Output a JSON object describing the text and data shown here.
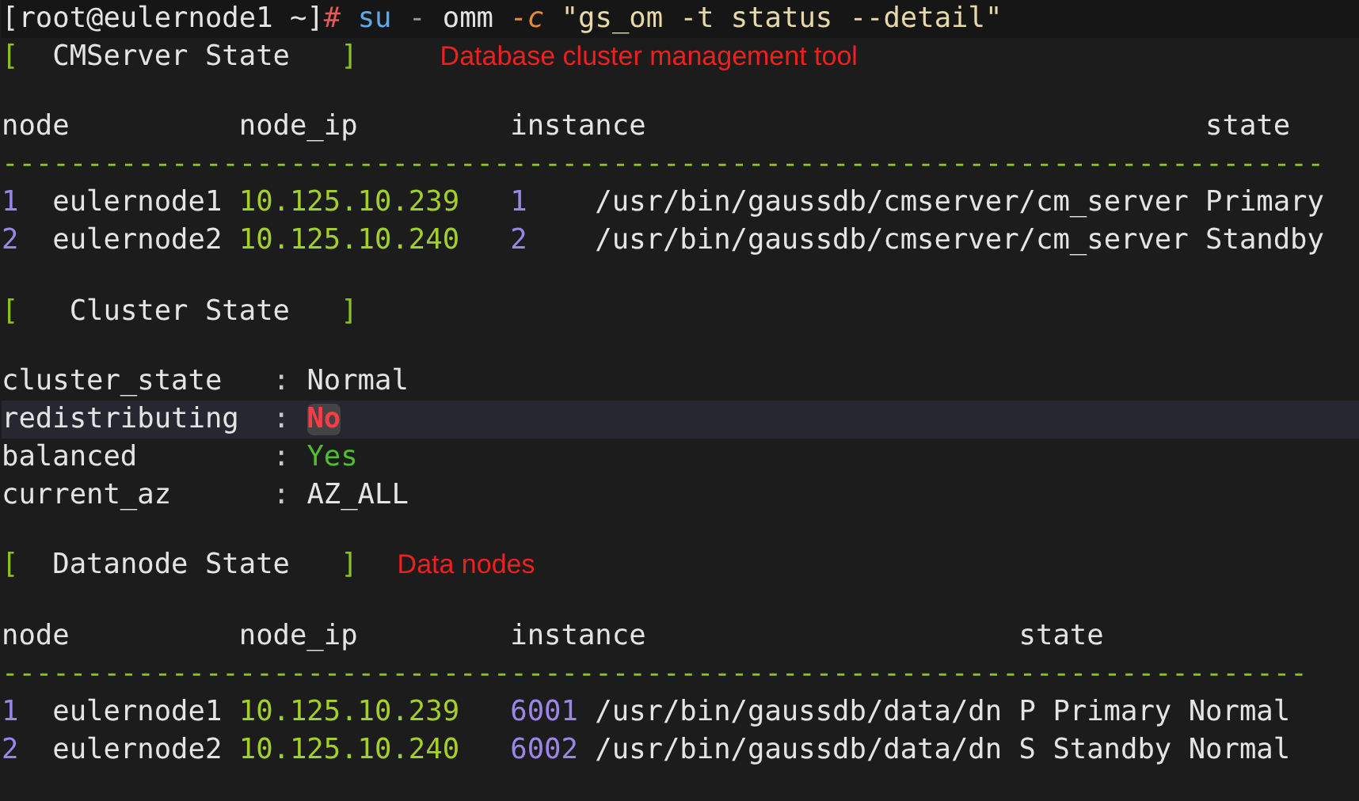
{
  "command": [
    {
      "kind": "prompt",
      "text": "[root@eulernode1 ~]"
    },
    {
      "kind": "symbol",
      "text": "#"
    },
    {
      "kind": "program",
      "text": "su"
    },
    {
      "kind": "dim",
      "text": "-"
    },
    {
      "kind": "plain",
      "text": "omm"
    },
    {
      "kind": "flag",
      "text": "-c"
    },
    {
      "kind": "string",
      "text": "\"gs_om -t status --detail\""
    }
  ],
  "sections": [
    {
      "kind": "table",
      "open": "[",
      "close": "]",
      "title": "CMServer State",
      "annotation": "Database cluster management tool",
      "columns": [
        "node",
        "node_ip",
        "instance",
        "state"
      ],
      "divider": "------------------------------------------------------------------------------",
      "rows": [
        {
          "index": "1",
          "node": "eulernode1",
          "node_ip": "10.125.10.239",
          "instance_id": "1",
          "path": "/usr/bin/gaussdb/cmserver/cm_server",
          "state": "Primary"
        },
        {
          "index": "2",
          "node": "eulernode2",
          "node_ip": "10.125.10.240",
          "instance_id": "2",
          "path": "/usr/bin/gaussdb/cmserver/cm_server",
          "state": "Standby"
        }
      ]
    },
    {
      "kind": "fields",
      "open": "[",
      "close": "]",
      "title": "Cluster State",
      "fields": [
        {
          "key": "cluster_state",
          "separator": ":",
          "value": "Normal",
          "color": "#e4e4e4",
          "selected": false
        },
        {
          "key": "redistributing",
          "separator": ":",
          "value": "No",
          "color": "#ff3b4a",
          "selected": true
        },
        {
          "key": "balanced",
          "separator": ":",
          "value": "Yes",
          "color": "#4fbf2f",
          "selected": false
        },
        {
          "key": "current_az",
          "separator": ":",
          "value": "AZ_ALL",
          "color": "#e4e4e4",
          "selected": false
        }
      ]
    },
    {
      "kind": "table",
      "open": "[",
      "close": "]",
      "title": "Datanode State",
      "annotation": "Data nodes",
      "columns": [
        "node",
        "node_ip",
        "instance",
        "state"
      ],
      "divider": "-----------------------------------------------------------------------------",
      "rows": [
        {
          "index": "1",
          "node": "eulernode1",
          "node_ip": "10.125.10.239",
          "instance_id": "6001",
          "path": "/usr/bin/gaussdb/data/dn",
          "state": "P Primary Normal"
        },
        {
          "index": "2",
          "node": "eulernode2",
          "node_ip": "10.125.10.240",
          "instance_id": "6002",
          "path": "/usr/bin/gaussdb/data/dn",
          "state": "S Standby Normal"
        }
      ]
    }
  ]
}
